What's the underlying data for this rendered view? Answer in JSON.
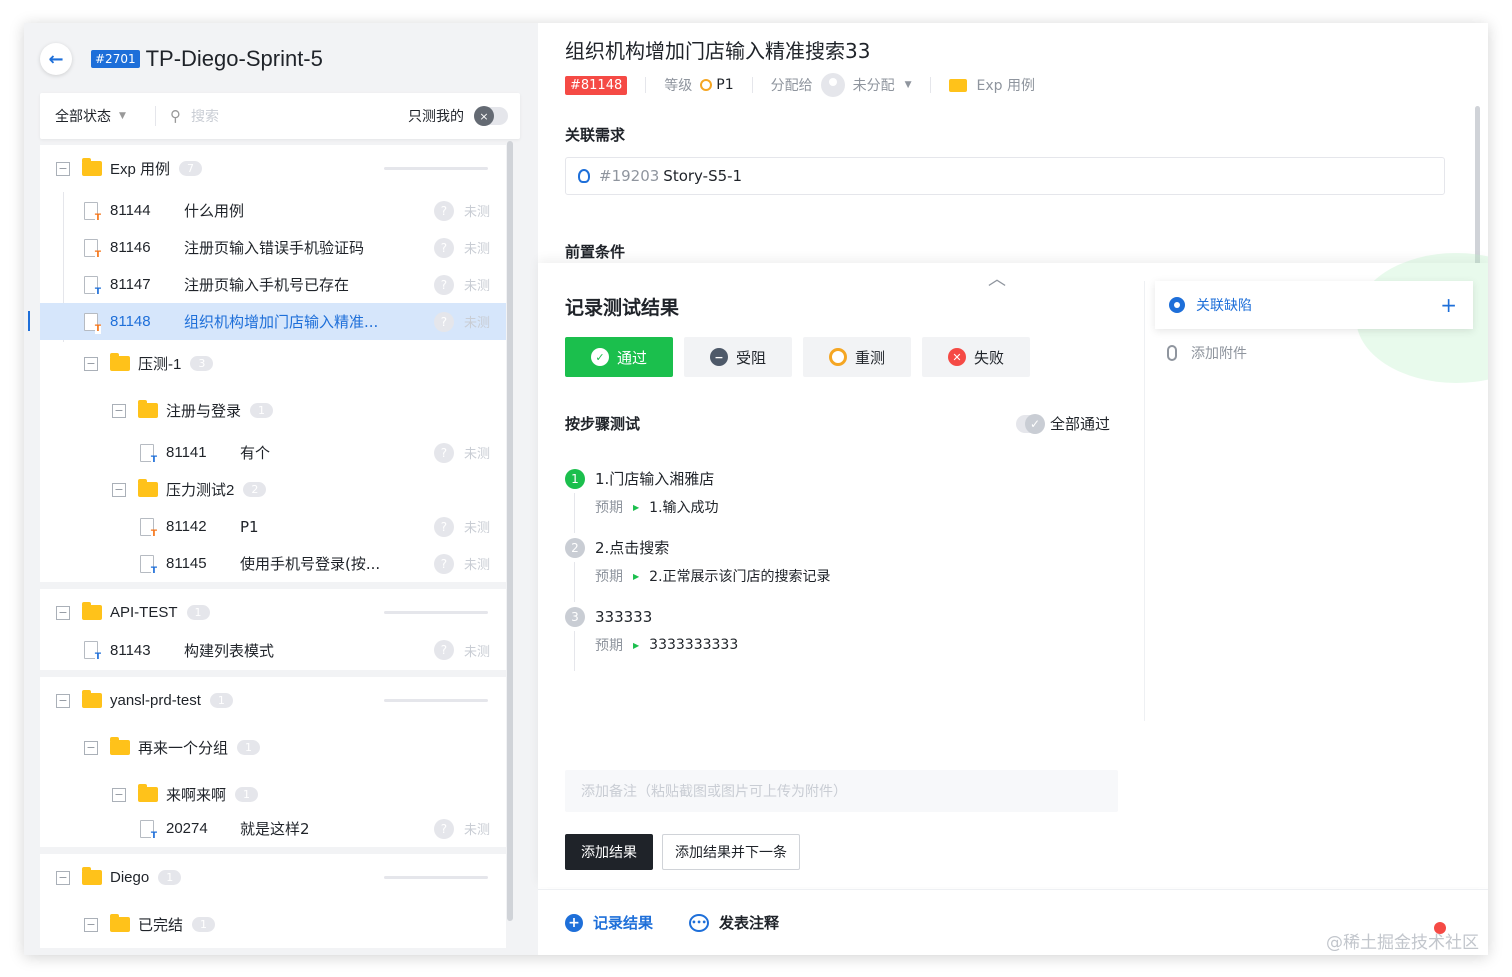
{
  "plan": {
    "id_tag": "#2701",
    "title": "TP-Diego-Sprint-5"
  },
  "filter": {
    "status": "全部状态",
    "search_placeholder": "搜索",
    "only_mine": "只测我的"
  },
  "tree": {
    "groups": [
      {
        "folder": "Exp 用例",
        "count": "7",
        "cases": [
          {
            "id": "81144",
            "title": "什么用例",
            "status": "未测"
          },
          {
            "id": "81146",
            "title": "注册页输入错误手机验证码",
            "status": "未测"
          },
          {
            "id": "81147",
            "title": "注册页输入手机号已存在",
            "status": "未测"
          },
          {
            "id": "81148",
            "title": "组织机构增加门店输入精准...",
            "status": "未测"
          }
        ],
        "sub": {
          "folder": "压测-1",
          "count": "3",
          "sub1": {
            "folder": "注册与登录",
            "count": "1",
            "case": {
              "id": "81141",
              "title": "有个",
              "status": "未测"
            }
          },
          "sub2": {
            "folder": "压力测试2",
            "count": "2",
            "cases": [
              {
                "id": "81142",
                "title": "P1",
                "status": "未测"
              },
              {
                "id": "81145",
                "title": "使用手机号登录(按...",
                "status": "未测"
              }
            ]
          }
        }
      },
      {
        "folder": "API-TEST",
        "count": "1",
        "case": {
          "id": "81143",
          "title": "构建列表模式",
          "status": "未测"
        }
      },
      {
        "folder": "yansl-prd-test",
        "count": "1",
        "sub": {
          "folder": "再来一个分组",
          "count": "1",
          "sub1": {
            "folder": "来啊来啊",
            "count": "1",
            "case": {
              "id": "20274",
              "title": "就是这样2",
              "status": "未测"
            }
          }
        }
      },
      {
        "folder": "Diego",
        "count": "1",
        "sub": {
          "folder": "已完结",
          "count": "1"
        }
      }
    ]
  },
  "case": {
    "title": "组织机构增加门店输入精准搜索33",
    "tag": "#81148",
    "level_label": "等级",
    "level": "P1",
    "assign_label": "分配给",
    "assignee": "未分配",
    "folder": "Exp 用例"
  },
  "requirement": {
    "label": "关联需求",
    "story_id": "#19203",
    "story_name": "Story-S5-1"
  },
  "precondition": {
    "label": "前置条件"
  },
  "record": {
    "title": "记录测试结果",
    "buttons": [
      "通过",
      "受阻",
      "重测",
      "失败"
    ],
    "steps_title": "按步骤测试",
    "all_pass": "全部通过",
    "expected_label": "预期",
    "steps": [
      {
        "num": "1",
        "text": "1.门店输入湘雅店",
        "expected": "1.输入成功"
      },
      {
        "num": "2",
        "text": "2.点击搜索",
        "expected": "2.正常展示该门店的搜索记录"
      },
      {
        "num": "3",
        "text": "333333",
        "expected": "3333333333"
      }
    ],
    "note_placeholder": "添加备注（粘贴截图或图片可上传为附件）",
    "add_result": "添加结果",
    "add_next": "添加结果并下一条"
  },
  "side": {
    "link_defect": "关联缺陷",
    "add_attachment": "添加附件"
  },
  "bottom": {
    "record_result": "记录结果",
    "comment": "发表注释"
  },
  "watermark": "@稀土掘金技术社区",
  "colors": {
    "primary": "#1e6fd9",
    "pass": "#1bbf4d",
    "fail": "#f54a45",
    "warn": "#f5a623",
    "folder": "#ffc21a"
  }
}
